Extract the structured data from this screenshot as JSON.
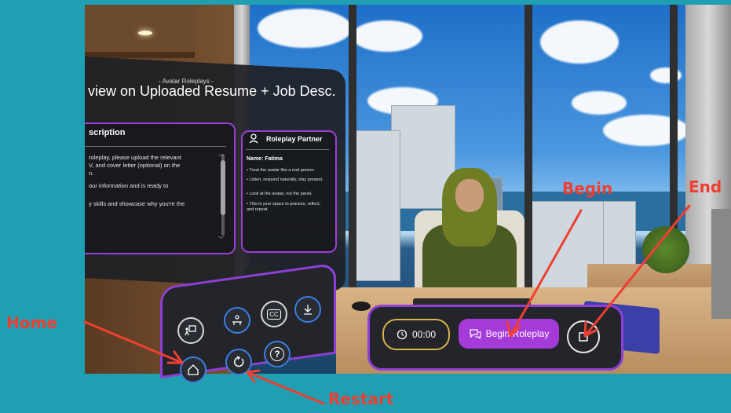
{
  "panel": {
    "subtitle": "- Avatar Roleplays -",
    "title": "view on Uploaded Resume + Job Desc."
  },
  "description": {
    "heading": "scription",
    "lines": [
      "roleplay, please upload the relevant",
      "V, and cover letter (optional) on the",
      "n.",
      "our information and is ready to",
      "y skills and showcase why you're the"
    ]
  },
  "partner": {
    "heading": "Roleplay Partner",
    "name": "Name: Fatima",
    "bullets": [
      "Treat the avatar like a real person.",
      "Listen, respond naturally, stay present.",
      "Look at the avatar, not the panel.",
      "This is your space to practice, reflect, and repeat."
    ]
  },
  "controls": {
    "timer": "00:00",
    "begin": "Begin Roleplay",
    "cc": "CC",
    "help": "?"
  },
  "annotations": {
    "begin": "Begin",
    "end": "End",
    "home": "Home",
    "restart": "Restart"
  },
  "colors": {
    "background": "#1f9fb1",
    "accent": "#a43ad8",
    "annotation": "#ef3f32",
    "timer_border": "#d4b44a"
  }
}
